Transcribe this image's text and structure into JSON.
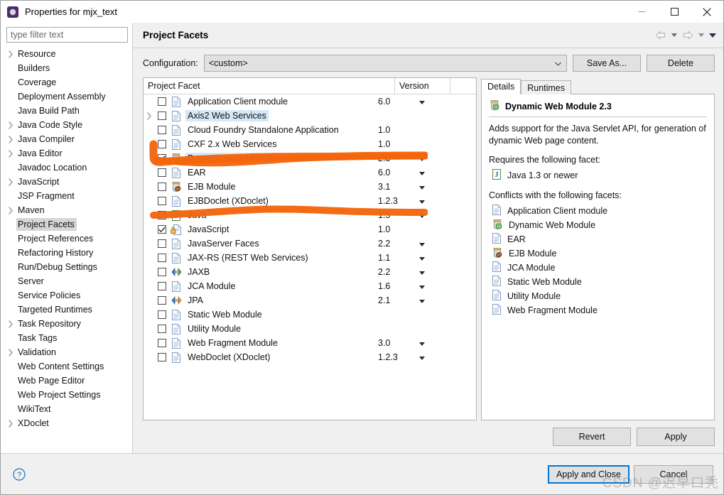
{
  "window": {
    "title": "Properties for mjx_text",
    "app_icon": "eclipse-properties-icon",
    "minimize": "—",
    "maximize": "□",
    "close": "✕"
  },
  "sidebar": {
    "filter_placeholder": "type filter text",
    "filter_value": "",
    "items": [
      {
        "label": "Resource",
        "expandable": true,
        "selected": false
      },
      {
        "label": "Builders",
        "expandable": false,
        "selected": false
      },
      {
        "label": "Coverage",
        "expandable": false,
        "selected": false
      },
      {
        "label": "Deployment Assembly",
        "expandable": false,
        "selected": false
      },
      {
        "label": "Java Build Path",
        "expandable": false,
        "selected": false
      },
      {
        "label": "Java Code Style",
        "expandable": true,
        "selected": false
      },
      {
        "label": "Java Compiler",
        "expandable": true,
        "selected": false
      },
      {
        "label": "Java Editor",
        "expandable": true,
        "selected": false
      },
      {
        "label": "Javadoc Location",
        "expandable": false,
        "selected": false
      },
      {
        "label": "JavaScript",
        "expandable": true,
        "selected": false
      },
      {
        "label": "JSP Fragment",
        "expandable": false,
        "selected": false
      },
      {
        "label": "Maven",
        "expandable": true,
        "selected": false
      },
      {
        "label": "Project Facets",
        "expandable": false,
        "selected": true
      },
      {
        "label": "Project References",
        "expandable": false,
        "selected": false
      },
      {
        "label": "Refactoring History",
        "expandable": false,
        "selected": false
      },
      {
        "label": "Run/Debug Settings",
        "expandable": false,
        "selected": false
      },
      {
        "label": "Server",
        "expandable": false,
        "selected": false
      },
      {
        "label": "Service Policies",
        "expandable": false,
        "selected": false
      },
      {
        "label": "Targeted Runtimes",
        "expandable": false,
        "selected": false
      },
      {
        "label": "Task Repository",
        "expandable": true,
        "selected": false
      },
      {
        "label": "Task Tags",
        "expandable": false,
        "selected": false
      },
      {
        "label": "Validation",
        "expandable": true,
        "selected": false
      },
      {
        "label": "Web Content Settings",
        "expandable": false,
        "selected": false
      },
      {
        "label": "Web Page Editor",
        "expandable": false,
        "selected": false
      },
      {
        "label": "Web Project Settings",
        "expandable": false,
        "selected": false
      },
      {
        "label": "WikiText",
        "expandable": false,
        "selected": false
      },
      {
        "label": "XDoclet",
        "expandable": true,
        "selected": false
      }
    ]
  },
  "page": {
    "title": "Project Facets",
    "nav_back_icon": "back-arrow-icon",
    "nav_forward_icon": "forward-arrow-icon",
    "nav_menu_icon": "view-menu-icon"
  },
  "configuration": {
    "label": "Configuration:",
    "value": "<custom>",
    "save_as_label": "Save As...",
    "delete_label": "Delete"
  },
  "facet_table": {
    "col_facet": "Project Facet",
    "col_version": "Version",
    "rows": [
      {
        "name": "Application Client module",
        "version": "6.0",
        "checked": false,
        "expandable": false,
        "highlight": false,
        "caret": true,
        "icon": "document-icon"
      },
      {
        "name": "Axis2 Web Services",
        "version": "",
        "checked": false,
        "expandable": true,
        "highlight": true,
        "caret": false,
        "icon": "document-icon"
      },
      {
        "name": "Cloud Foundry Standalone Application",
        "version": "1.0",
        "checked": false,
        "expandable": false,
        "highlight": false,
        "caret": false,
        "icon": "document-icon"
      },
      {
        "name": "CXF 2.x Web Services",
        "version": "1.0",
        "checked": false,
        "expandable": false,
        "highlight": false,
        "caret": false,
        "icon": "document-icon"
      },
      {
        "name": "Dynamic Web Module",
        "version": "2.3",
        "checked": true,
        "expandable": false,
        "highlight": true,
        "caret": true,
        "icon": "web-module-icon"
      },
      {
        "name": "EAR",
        "version": "6.0",
        "checked": false,
        "expandable": false,
        "highlight": false,
        "caret": true,
        "icon": "document-icon"
      },
      {
        "name": "EJB Module",
        "version": "3.1",
        "checked": false,
        "expandable": false,
        "highlight": false,
        "caret": true,
        "icon": "ejb-module-icon"
      },
      {
        "name": "EJBDoclet (XDoclet)",
        "version": "1.2.3",
        "checked": false,
        "expandable": false,
        "highlight": false,
        "caret": true,
        "icon": "document-icon"
      },
      {
        "name": "Java",
        "version": "1.5",
        "checked": true,
        "expandable": false,
        "highlight": false,
        "caret": true,
        "icon": "java-icon"
      },
      {
        "name": "JavaScript",
        "version": "1.0",
        "checked": true,
        "expandable": false,
        "highlight": false,
        "caret": false,
        "icon": "javascript-locked-icon"
      },
      {
        "name": "JavaServer Faces",
        "version": "2.2",
        "checked": false,
        "expandable": false,
        "highlight": false,
        "caret": true,
        "icon": "document-icon"
      },
      {
        "name": "JAX-RS (REST Web Services)",
        "version": "1.1",
        "checked": false,
        "expandable": false,
        "highlight": false,
        "caret": true,
        "icon": "document-icon"
      },
      {
        "name": "JAXB",
        "version": "2.2",
        "checked": false,
        "expandable": false,
        "highlight": false,
        "caret": true,
        "icon": "jaxb-icon"
      },
      {
        "name": "JCA Module",
        "version": "1.6",
        "checked": false,
        "expandable": false,
        "highlight": false,
        "caret": true,
        "icon": "document-icon"
      },
      {
        "name": "JPA",
        "version": "2.1",
        "checked": false,
        "expandable": false,
        "highlight": false,
        "caret": true,
        "icon": "jpa-icon"
      },
      {
        "name": "Static Web Module",
        "version": "",
        "checked": false,
        "expandable": false,
        "highlight": false,
        "caret": false,
        "icon": "document-icon"
      },
      {
        "name": "Utility Module",
        "version": "",
        "checked": false,
        "expandable": false,
        "highlight": false,
        "caret": false,
        "icon": "document-icon"
      },
      {
        "name": "Web Fragment Module",
        "version": "3.0",
        "checked": false,
        "expandable": false,
        "highlight": false,
        "caret": true,
        "icon": "document-icon"
      },
      {
        "name": "WebDoclet (XDoclet)",
        "version": "1.2.3",
        "checked": false,
        "expandable": false,
        "highlight": false,
        "caret": true,
        "icon": "document-icon"
      }
    ]
  },
  "details": {
    "tabs": [
      {
        "label": "Details",
        "active": true
      },
      {
        "label": "Runtimes",
        "active": false
      }
    ],
    "title": "Dynamic Web Module 2.3",
    "title_icon": "web-module-icon",
    "description": "Adds support for the Java Servlet API, for generation of dynamic Web page content.",
    "requires_label": "Requires the following facet:",
    "requires": [
      {
        "label": "Java 1.3 or newer",
        "icon": "java-icon"
      }
    ],
    "conflicts_label": "Conflicts with the following facets:",
    "conflicts": [
      {
        "label": "Application Client module",
        "icon": "document-icon"
      },
      {
        "label": "Dynamic Web Module",
        "icon": "web-module-icon"
      },
      {
        "label": "EAR",
        "icon": "document-icon"
      },
      {
        "label": "EJB Module",
        "icon": "ejb-module-icon"
      },
      {
        "label": "JCA Module",
        "icon": "document-icon"
      },
      {
        "label": "Static Web Module",
        "icon": "document-icon"
      },
      {
        "label": "Utility Module",
        "icon": "document-icon"
      },
      {
        "label": "Web Fragment Module",
        "icon": "document-icon"
      }
    ]
  },
  "apply_bar": {
    "revert_label": "Revert",
    "apply_label": "Apply"
  },
  "footer": {
    "help_icon": "help-question-icon",
    "apply_close_label": "Apply and Close",
    "cancel_label": "Cancel"
  },
  "annotations": {
    "marker_color": "#f4650c",
    "strokes": [
      {
        "target": "Dynamic Web Module row",
        "kind": "brush-underline-with-left-hook"
      },
      {
        "target": "Java row",
        "kind": "brush-underline"
      }
    ]
  },
  "watermark": {
    "text": "CSDN @迟早口秃"
  }
}
